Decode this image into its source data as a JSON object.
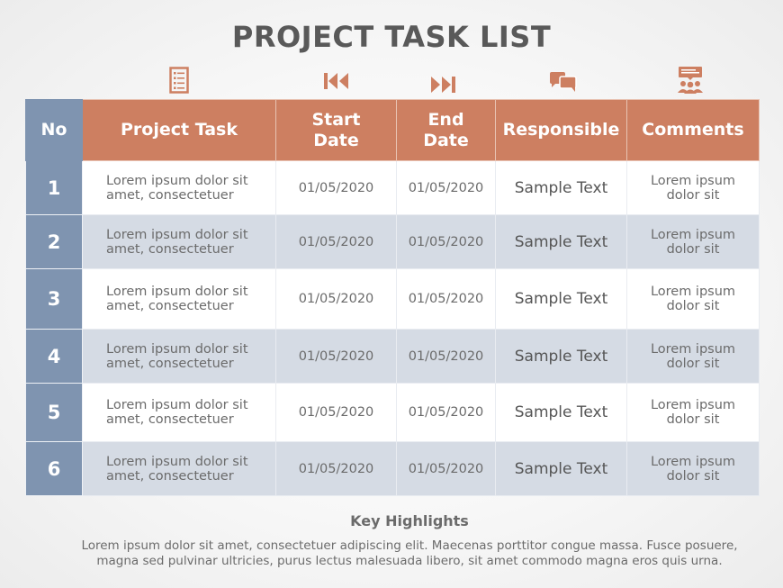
{
  "title": "PROJECT TASK LIST",
  "colors": {
    "header": "#cd7f61",
    "no_column": "#7f94b0",
    "row_alt": "#d5dbe4",
    "row": "#ffffff",
    "text": "#595959"
  },
  "header_icons": [
    {
      "column": "Project Task",
      "icon": "checklist-icon"
    },
    {
      "column": "Start Date",
      "icon": "skip-back-icon"
    },
    {
      "column": "End Date",
      "icon": "skip-forward-icon"
    },
    {
      "column": "Responsible",
      "icon": "chat-bubbles-icon"
    },
    {
      "column": "Comments",
      "icon": "meeting-group-icon"
    }
  ],
  "table": {
    "headers": {
      "no": "No",
      "task": "Project Task",
      "start_l1": "Start",
      "start_l2": "Date",
      "end_l1": "End",
      "end_l2": "Date",
      "responsible": "Responsible",
      "comments": "Comments"
    },
    "rows": [
      {
        "no": "1",
        "task_l1": "Lorem ipsum dolor sit",
        "task_l2": "amet, consectetuer",
        "start": "01/05/2020",
        "end": "01/05/2020",
        "responsible": "Sample Text",
        "comment_l1": "Lorem ipsum",
        "comment_l2": "dolor sit"
      },
      {
        "no": "2",
        "task_l1": "Lorem ipsum dolor sit",
        "task_l2": "amet, consectetuer",
        "start": "01/05/2020",
        "end": "01/05/2020",
        "responsible": "Sample Text",
        "comment_l1": "Lorem ipsum",
        "comment_l2": "dolor sit"
      },
      {
        "no": "3",
        "task_l1": "Lorem ipsum dolor sit",
        "task_l2": "amet, consectetuer",
        "start": "01/05/2020",
        "end": "01/05/2020",
        "responsible": "Sample Text",
        "comment_l1": "Lorem ipsum",
        "comment_l2": "dolor sit"
      },
      {
        "no": "4",
        "task_l1": "Lorem ipsum dolor sit",
        "task_l2": "amet, consectetuer",
        "start": "01/05/2020",
        "end": "01/05/2020",
        "responsible": "Sample Text",
        "comment_l1": "Lorem ipsum",
        "comment_l2": "dolor sit"
      },
      {
        "no": "5",
        "task_l1": "Lorem ipsum dolor sit",
        "task_l2": "amet, consectetuer",
        "start": "01/05/2020",
        "end": "01/05/2020",
        "responsible": "Sample Text",
        "comment_l1": "Lorem ipsum",
        "comment_l2": "dolor sit"
      },
      {
        "no": "6",
        "task_l1": "Lorem ipsum dolor sit",
        "task_l2": "amet, consectetuer",
        "start": "01/05/2020",
        "end": "01/05/2020",
        "responsible": "Sample Text",
        "comment_l1": "Lorem ipsum",
        "comment_l2": "dolor sit"
      }
    ]
  },
  "key_highlights": {
    "title": "Key Highlights",
    "line1": "Lorem ipsum dolor sit amet, consectetuer adipiscing elit. Maecenas porttitor congue massa. Fusce posuere,",
    "line2": "magna sed pulvinar ultricies, purus lectus malesuada libero, sit amet commodo magna eros quis urna."
  }
}
